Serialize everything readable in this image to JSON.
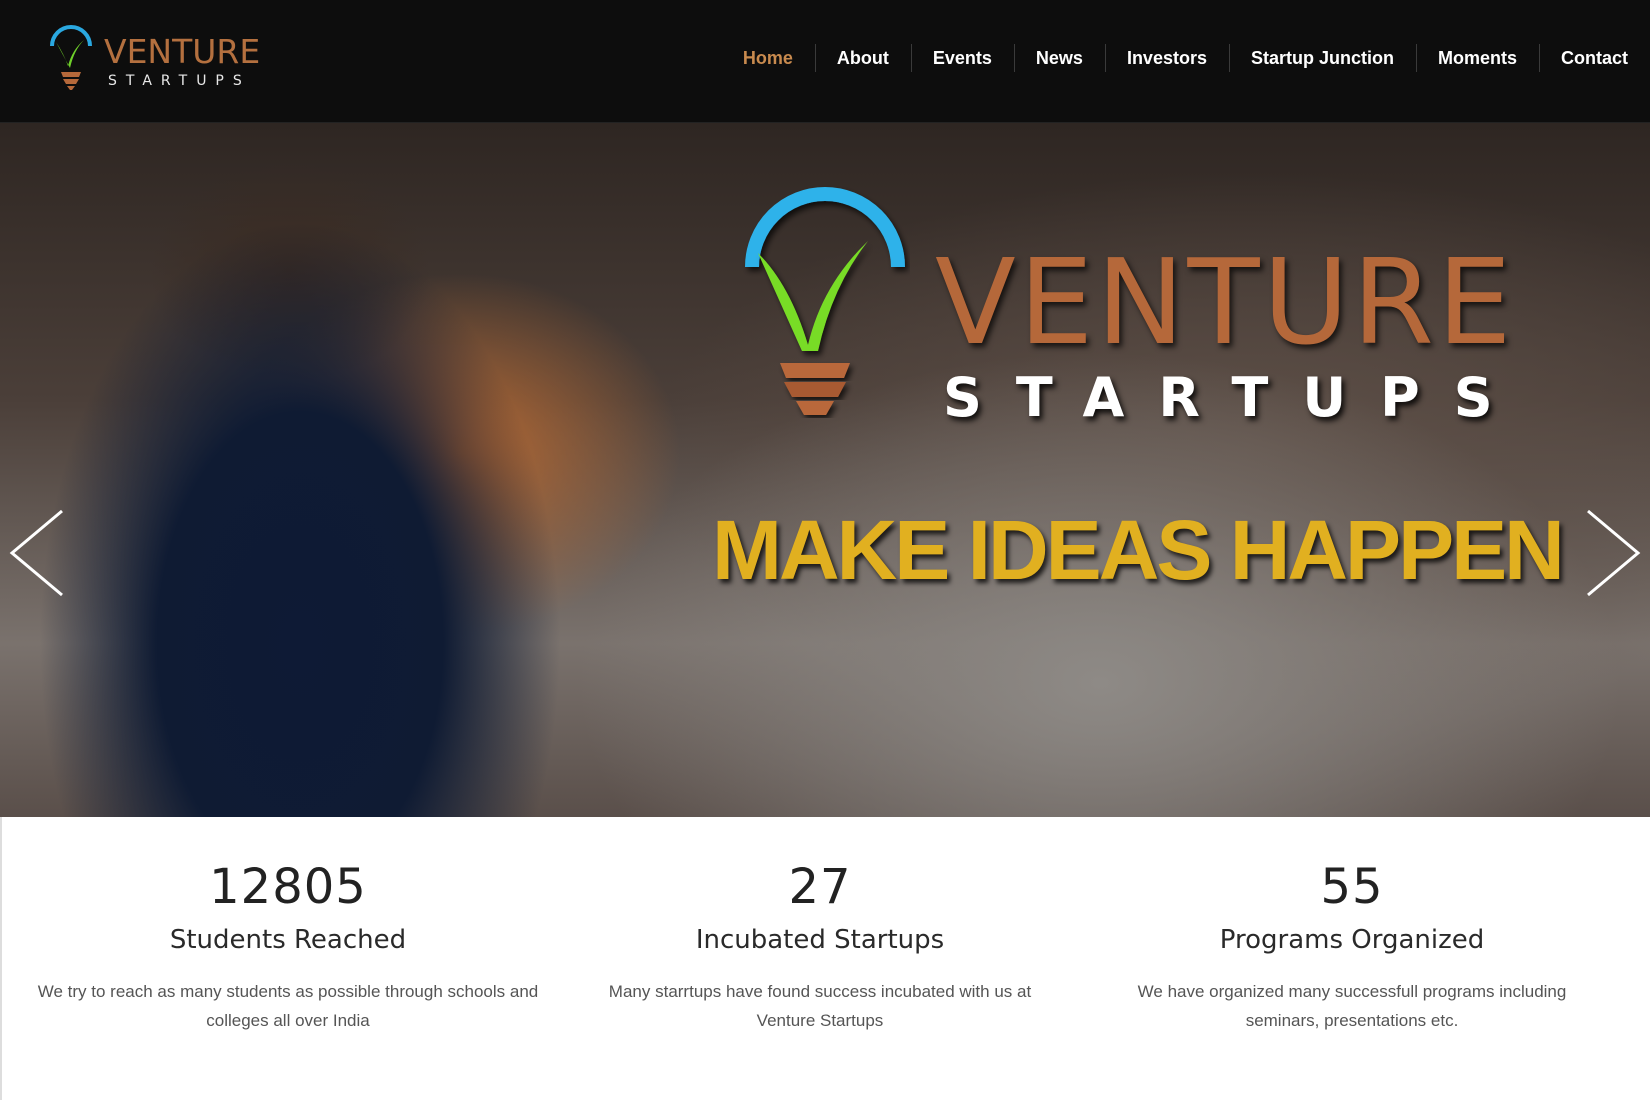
{
  "header": {
    "logo": {
      "name": "VENTURE",
      "tagline": "STARTUPS"
    },
    "nav": [
      {
        "label": "Home",
        "active": true
      },
      {
        "label": "About",
        "active": false
      },
      {
        "label": "Events",
        "active": false
      },
      {
        "label": "News",
        "active": false
      },
      {
        "label": "Investors",
        "active": false
      },
      {
        "label": "Startup Junction",
        "active": false
      },
      {
        "label": "Moments",
        "active": false
      },
      {
        "label": "Contact",
        "active": false
      }
    ]
  },
  "hero": {
    "title": "VENTURE",
    "subtitle": "STARTUPS",
    "tagline": "MAKE IDEAS HAPPEN",
    "prev_icon": "chevron-left-icon",
    "next_icon": "chevron-right-icon"
  },
  "stats": [
    {
      "number": "12805",
      "title": "Students Reached",
      "description": "We try to reach as many students as possible through schools and colleges all over India"
    },
    {
      "number": "27",
      "title": "Incubated Startups",
      "description": "Many starrtups have found success incubated with us at Venture Startups"
    },
    {
      "number": "55",
      "title": "Programs Organized",
      "description": "We have organized many successfull programs including seminars, presentations etc."
    }
  ],
  "colors": {
    "header_bg": "#0d0d0d",
    "nav_active": "#c88a4e",
    "brand_orange": "#b5683a",
    "tagline_gold": "#e1b020",
    "bulb_blue": "#2aa8e0",
    "bulb_green": "#6fd02a"
  }
}
